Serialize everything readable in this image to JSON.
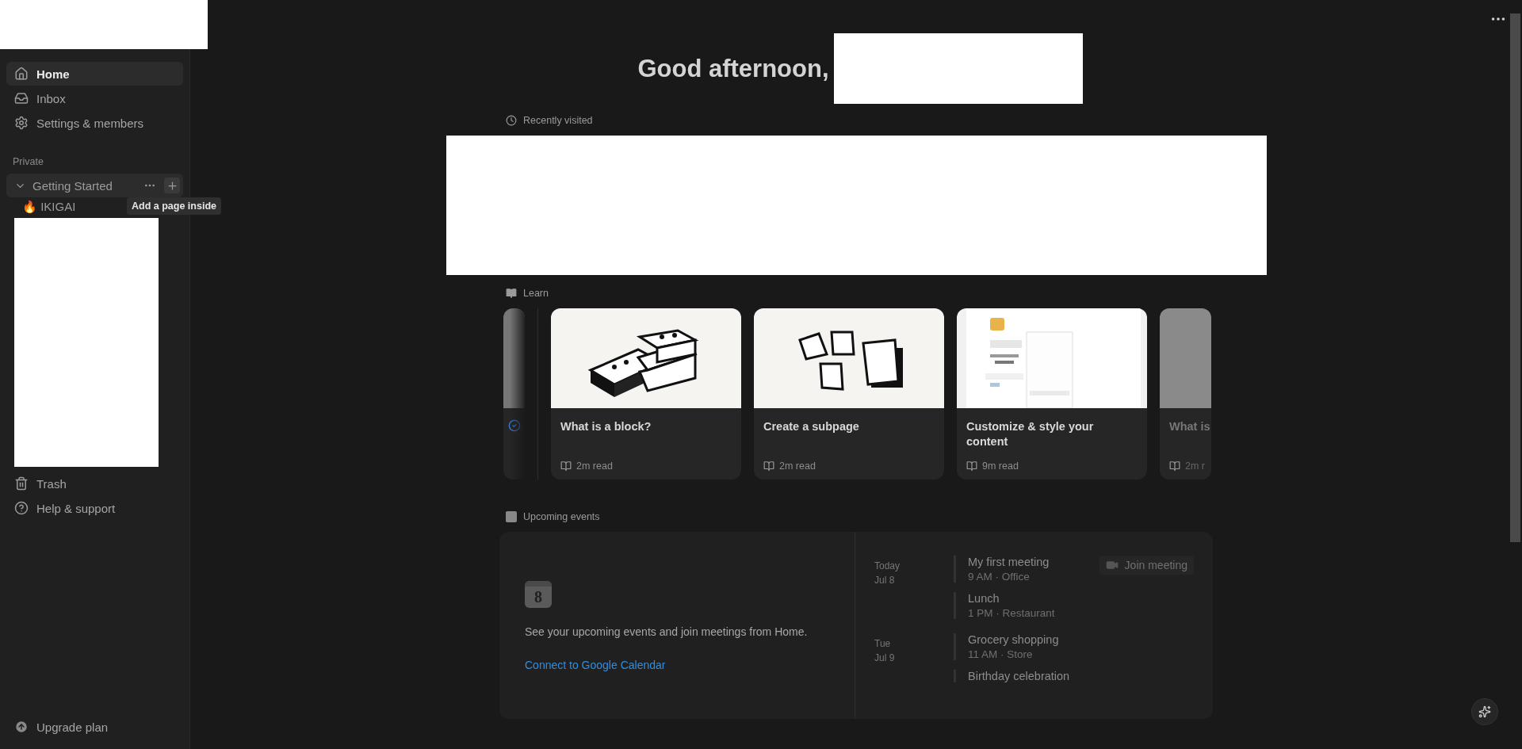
{
  "sidebar": {
    "nav": [
      {
        "label": "Home",
        "selected": true
      },
      {
        "label": "Inbox",
        "selected": false
      },
      {
        "label": "Settings & members",
        "selected": false
      }
    ],
    "section_label": "Private",
    "pages": [
      {
        "label": "Getting Started",
        "expanded": true,
        "hovered": true,
        "children": [
          {
            "label": "IKIGAI",
            "icon": "🔥"
          }
        ]
      }
    ],
    "tooltip": "Add a page inside",
    "bottom_nav": [
      {
        "label": "Trash"
      },
      {
        "label": "Help & support"
      }
    ],
    "upgrade": "Upgrade plan"
  },
  "greeting": "Good afternoon,",
  "recently_visited": {
    "title": "Recently visited"
  },
  "learn": {
    "title": "Learn",
    "cards": [
      {
        "kind": "stub"
      },
      {
        "kind": "bricks",
        "title": "What is a block?",
        "read": "2m read"
      },
      {
        "kind": "notes",
        "title": "Create a subpage",
        "read": "2m read"
      },
      {
        "kind": "screenshot",
        "title": "Customize & style your content",
        "read": "9m read"
      },
      {
        "kind": "peek",
        "title": "What is",
        "read": "2m r"
      }
    ]
  },
  "events": {
    "title": "Upcoming events",
    "calendar_day": "8",
    "prompt": "See your upcoming events and join meetings from Home.",
    "link": "Connect to Google Calendar",
    "days": [
      {
        "day": "Today",
        "date": "Jul 8",
        "items": [
          {
            "name": "My first meeting",
            "detail": "9 AM · Office",
            "join": "Join meeting"
          },
          {
            "name": "Lunch",
            "detail": "1 PM · Restaurant"
          }
        ]
      },
      {
        "day": "Tue",
        "date": "Jul 9",
        "items": [
          {
            "name": "Grocery shopping",
            "detail": "11 AM · Store"
          },
          {
            "name": "Birthday celebration"
          }
        ]
      }
    ]
  }
}
